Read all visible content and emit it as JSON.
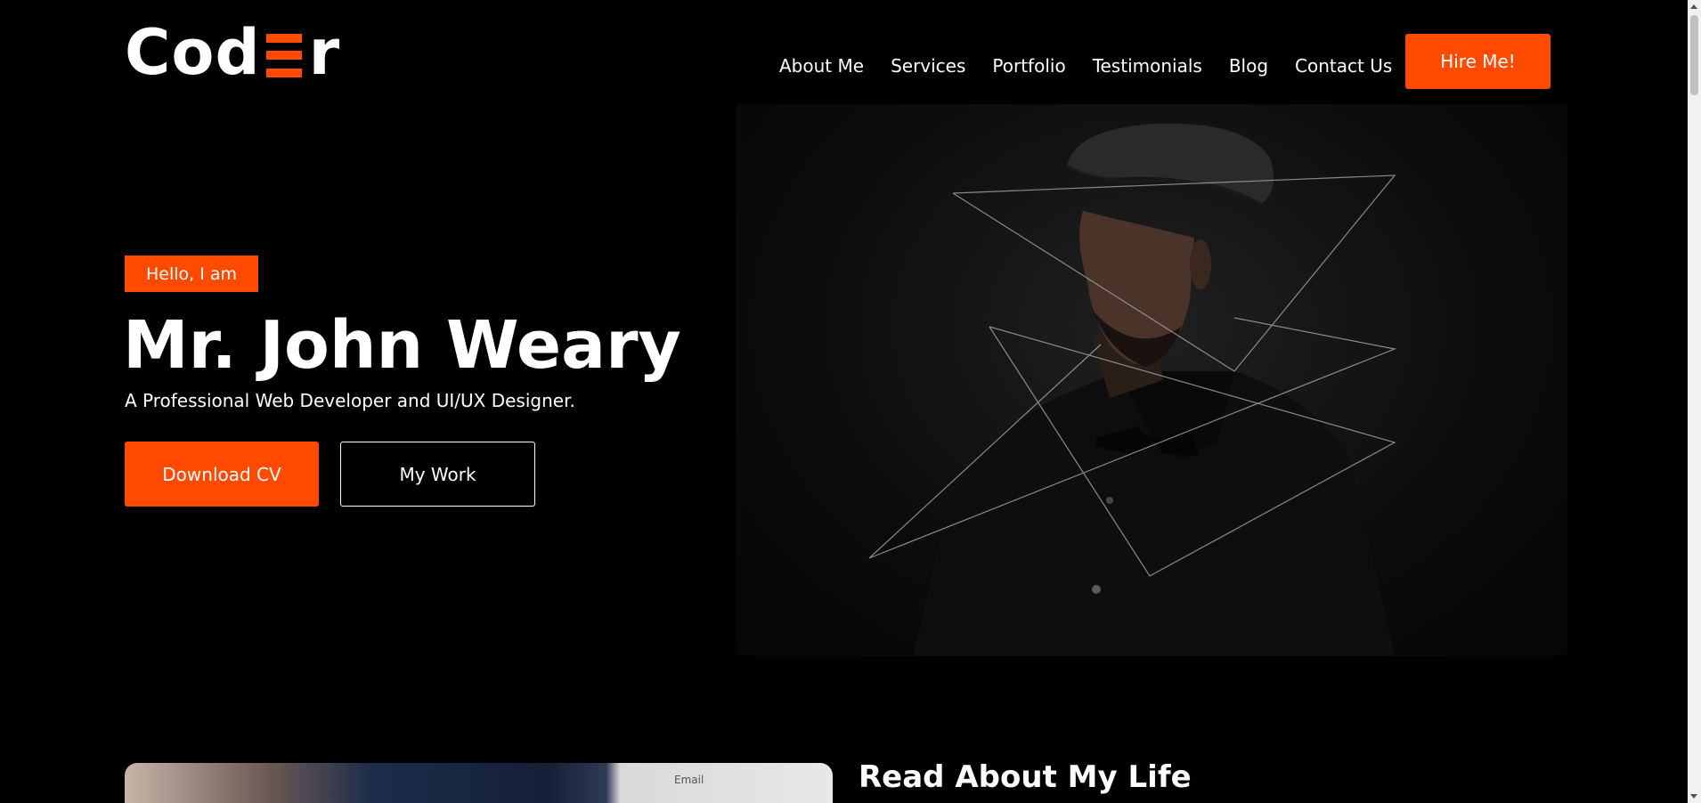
{
  "brand": {
    "logo_left": "Cod",
    "logo_right": "r",
    "accent_color": "#ff4a00"
  },
  "nav": {
    "items": [
      "About Me",
      "Services",
      "Portfolio",
      "Testimonials",
      "Blog",
      "Contact Us"
    ],
    "hire_label": "Hire Me!"
  },
  "hero": {
    "badge": "Hello, I am",
    "name": "Mr. John Weary",
    "tagline": "A Professional Web Developer and UI/UX Designer.",
    "cv_button": "Download CV",
    "work_button": "My Work"
  },
  "about": {
    "title": "Read About My Life",
    "image_email_text": "Email"
  }
}
